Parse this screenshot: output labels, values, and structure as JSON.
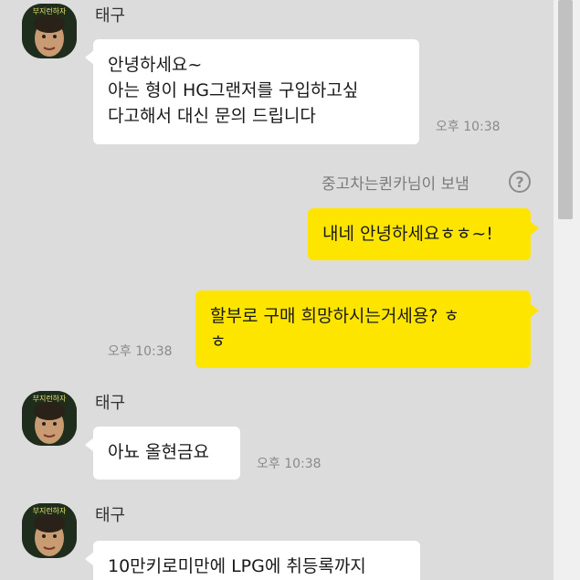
{
  "messages": {
    "m1": {
      "sender": "태구",
      "text": "안녕하세요~\n아는 형이 HG그랜저를 구입하고싶\n다고해서 대신 문의 드립니다",
      "time": "오후 10:38"
    },
    "notice": {
      "text": "중고차는퀸카님이 보냄",
      "help_icon": "?"
    },
    "m2": {
      "text": "내네 안녕하세요ㅎㅎ~!"
    },
    "m3": {
      "text": "할부로 구매 희망하시는거세용? ㅎ\nㅎ",
      "time": "오후 10:38"
    },
    "m4": {
      "sender": "태구",
      "text": "아뇨 올현금요",
      "time": "오후 10:38"
    },
    "m5": {
      "sender": "태구",
      "text": "10만키로미만에 LPG에 취등록까지"
    }
  },
  "avatar": {
    "caption": "부지런하자",
    "icon": "profile-photo"
  },
  "colors": {
    "background": "#dcdcdc",
    "incoming": "#ffffff",
    "outgoing": "#fee500",
    "time": "#8a8a8a"
  }
}
